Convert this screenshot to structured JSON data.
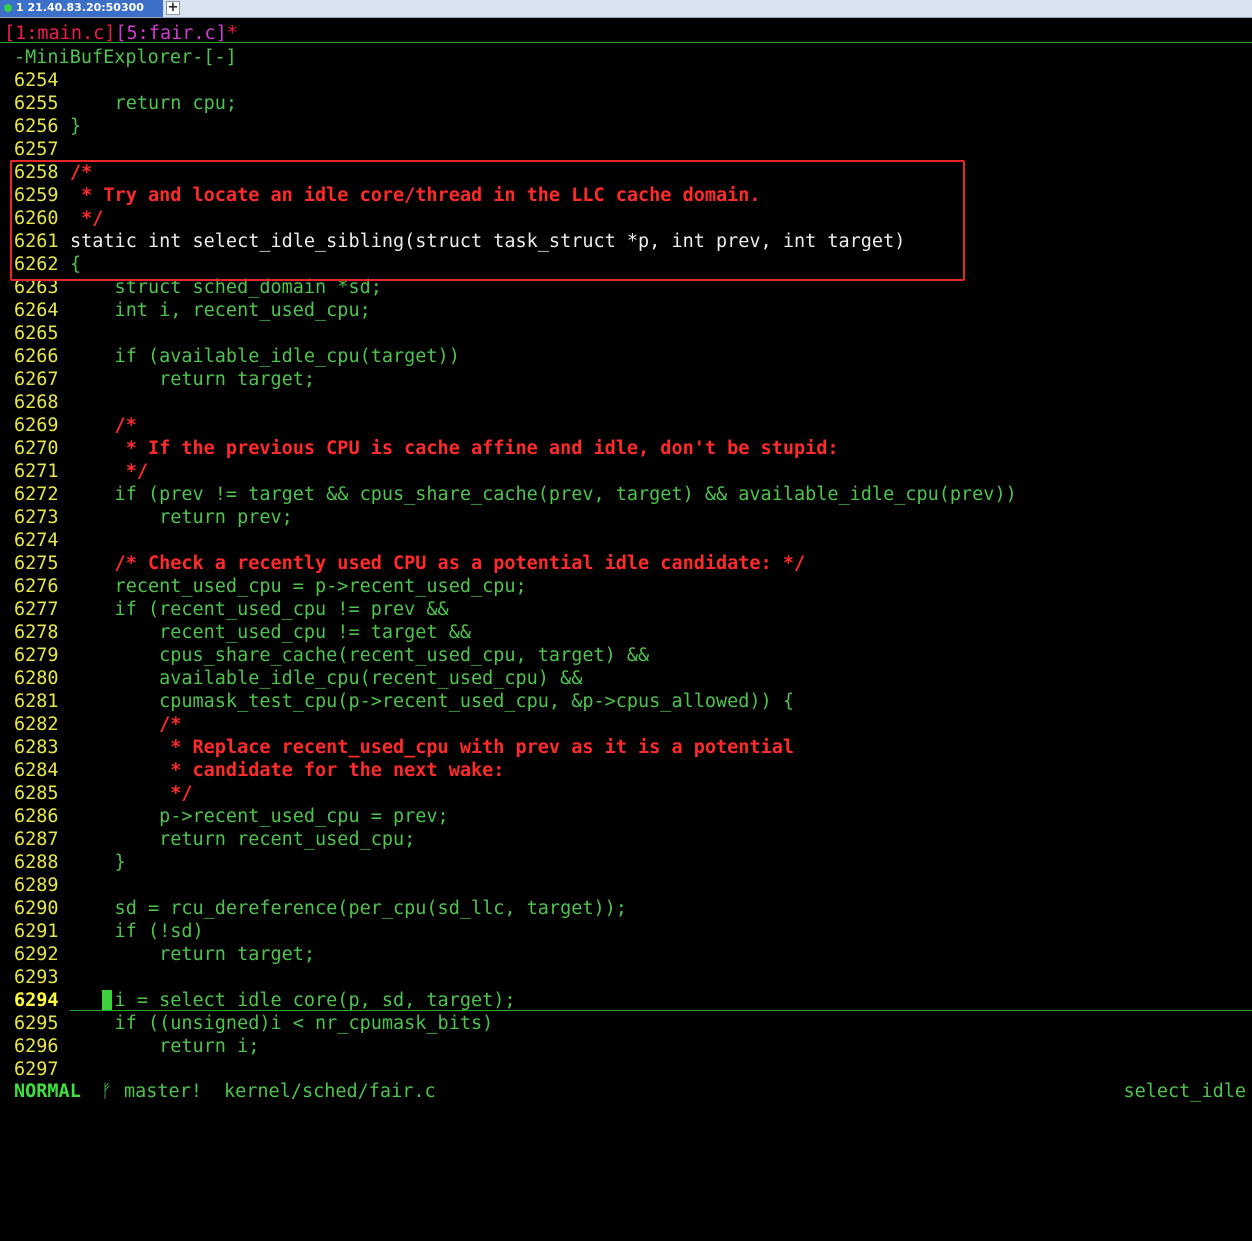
{
  "tab": {
    "title": "1 21.40.83.20:50300",
    "new_tab": "+"
  },
  "buffers": {
    "main": "[1:main.c]",
    "fair": "[5:fair.c]",
    "modified": "*"
  },
  "minibuf": "-MiniBufExplorer-[-]",
  "code_lines": [
    {
      "n": "6254",
      "t": "",
      "k": "g"
    },
    {
      "n": "6255",
      "t": "    return cpu;",
      "k": "g"
    },
    {
      "n": "6256",
      "t": "}",
      "k": "g"
    },
    {
      "n": "6257",
      "t": "",
      "k": "g"
    },
    {
      "n": "6258",
      "t": "/*",
      "k": "c"
    },
    {
      "n": "6259",
      "t": " * Try and locate an idle core/thread in the LLC cache domain.",
      "k": "c"
    },
    {
      "n": "6260",
      "t": " */",
      "k": "c"
    },
    {
      "n": "6261",
      "t": "static int select_idle_sibling(struct task_struct *p, int prev, int target)",
      "k": "w"
    },
    {
      "n": "6262",
      "t": "{",
      "k": "g"
    },
    {
      "n": "6263",
      "t": "    struct sched_domain *sd;",
      "k": "g"
    },
    {
      "n": "6264",
      "t": "    int i, recent_used_cpu;",
      "k": "g"
    },
    {
      "n": "6265",
      "t": "",
      "k": "g"
    },
    {
      "n": "6266",
      "t": "    if (available_idle_cpu(target))",
      "k": "g"
    },
    {
      "n": "6267",
      "t": "        return target;",
      "k": "g"
    },
    {
      "n": "6268",
      "t": "",
      "k": "g"
    },
    {
      "n": "6269",
      "t": "    /*",
      "k": "c"
    },
    {
      "n": "6270",
      "t": "     * If the previous CPU is cache affine and idle, don't be stupid:",
      "k": "c"
    },
    {
      "n": "6271",
      "t": "     */",
      "k": "c"
    },
    {
      "n": "6272",
      "t": "    if (prev != target && cpus_share_cache(prev, target) && available_idle_cpu(prev))",
      "k": "g"
    },
    {
      "n": "6273",
      "t": "        return prev;",
      "k": "g"
    },
    {
      "n": "6274",
      "t": "",
      "k": "g"
    },
    {
      "n": "6275",
      "t": "    /* Check a recently used CPU as a potential idle candidate: */",
      "k": "c"
    },
    {
      "n": "6276",
      "t": "    recent_used_cpu = p->recent_used_cpu;",
      "k": "g"
    },
    {
      "n": "6277",
      "t": "    if (recent_used_cpu != prev &&",
      "k": "g"
    },
    {
      "n": "6278",
      "t": "        recent_used_cpu != target &&",
      "k": "g"
    },
    {
      "n": "6279",
      "t": "        cpus_share_cache(recent_used_cpu, target) &&",
      "k": "g"
    },
    {
      "n": "6280",
      "t": "        available_idle_cpu(recent_used_cpu) &&",
      "k": "g"
    },
    {
      "n": "6281",
      "t": "        cpumask_test_cpu(p->recent_used_cpu, &p->cpus_allowed)) {",
      "k": "g"
    },
    {
      "n": "6282",
      "t": "        /*",
      "k": "c"
    },
    {
      "n": "6283",
      "t": "         * Replace recent_used_cpu with prev as it is a potential",
      "k": "c"
    },
    {
      "n": "6284",
      "t": "         * candidate for the next wake:",
      "k": "c"
    },
    {
      "n": "6285",
      "t": "         */",
      "k": "c"
    },
    {
      "n": "6286",
      "t": "        p->recent_used_cpu = prev;",
      "k": "g"
    },
    {
      "n": "6287",
      "t": "        return recent_used_cpu;",
      "k": "g"
    },
    {
      "n": "6288",
      "t": "    }",
      "k": "g"
    },
    {
      "n": "6289",
      "t": "",
      "k": "g"
    },
    {
      "n": "6290",
      "t": "    sd = rcu_dereference(per_cpu(sd_llc, target));",
      "k": "g"
    },
    {
      "n": "6291",
      "t": "    if (!sd)",
      "k": "g"
    },
    {
      "n": "6292",
      "t": "        return target;",
      "k": "g"
    },
    {
      "n": "6293",
      "t": "",
      "k": "g"
    },
    {
      "n": "6294",
      "t": "    i = select_idle_core(p, sd, target);",
      "k": "g",
      "cur": true
    },
    {
      "n": "6295",
      "t": "    if ((unsigned)i < nr_cpumask_bits)",
      "k": "g"
    },
    {
      "n": "6296",
      "t": "        return i;",
      "k": "g"
    },
    {
      "n": "6297",
      "t": "",
      "k": "g"
    }
  ],
  "status": {
    "mode": "NORMAL",
    "branch_icon": "ᚠ",
    "branch": "master!",
    "path": "kernel/sched/fair.c",
    "function": "select_idle"
  },
  "colors": {
    "background": "#000000",
    "code": "#4ec34e",
    "comment": "#ff2a2a",
    "line_number": "#e6e64a",
    "highlight_box": "#e8262a"
  }
}
